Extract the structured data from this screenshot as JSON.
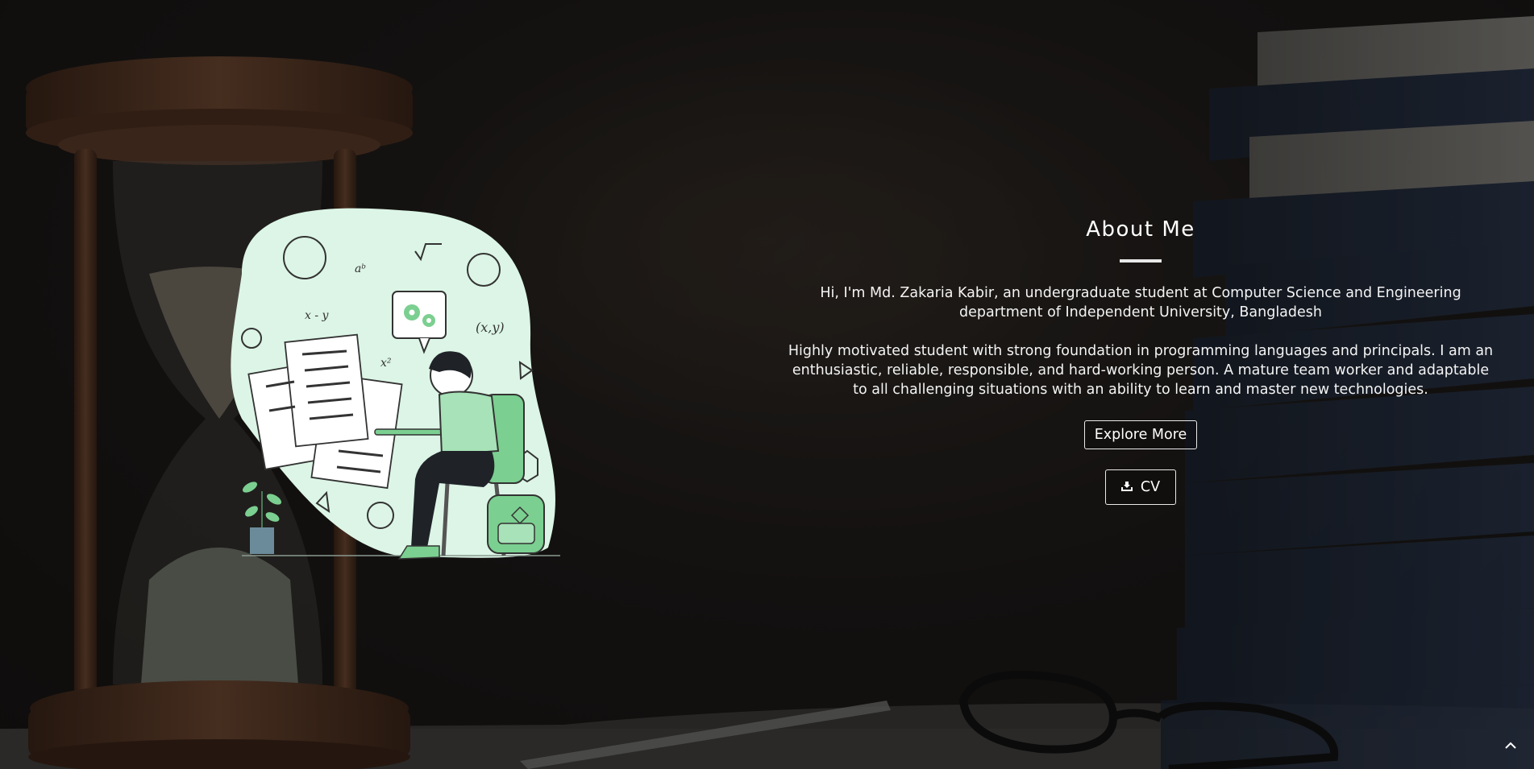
{
  "about": {
    "title": "About Me",
    "intro": "Hi, I'm Md. Zakaria Kabir, an undergraduate student at Computer Science and Engineering department of Independent University, Bangladesh",
    "description": "Highly motivated student with strong foundation in programming languages and principals. I am an enthusiastic, reliable, responsible, and hard-working person. A mature team worker and adaptable to all challenging situations with an ability to learn and master new technologies.",
    "explore_label": "Explore More",
    "cv_label": "CV",
    "cv_icon": "download-icon"
  },
  "scroll_top_icon": "chevron-up-icon",
  "colors": {
    "illustration_bg": "#dcf5e6",
    "accent_green": "#7bcf90",
    "text": "#ffffff"
  }
}
